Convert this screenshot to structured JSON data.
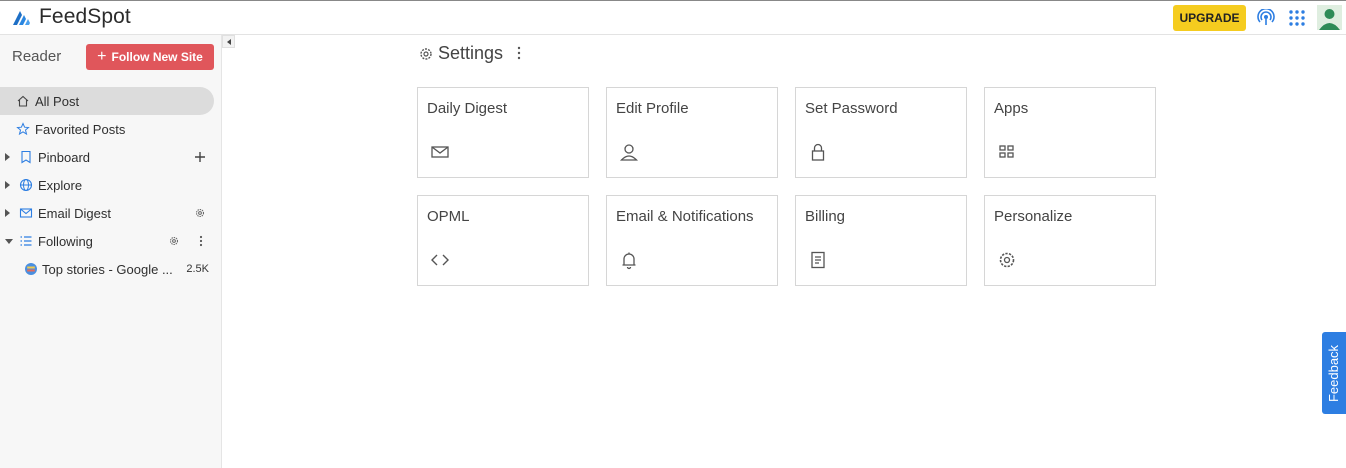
{
  "app": {
    "name": "FeedSpot"
  },
  "header": {
    "upgrade_label": "UPGRADE"
  },
  "sidebar": {
    "reader_label": "Reader",
    "follow_button": "Follow New Site",
    "items": [
      {
        "label": "All Post"
      },
      {
        "label": "Favorited Posts"
      },
      {
        "label": "Pinboard"
      },
      {
        "label": "Explore"
      },
      {
        "label": "Email Digest"
      },
      {
        "label": "Following"
      },
      {
        "label": "Top stories - Google ...",
        "count": "2.5K"
      }
    ]
  },
  "main": {
    "title": "Settings",
    "cards": [
      {
        "label": "Daily Digest",
        "icon": "mail-icon"
      },
      {
        "label": "Edit Profile",
        "icon": "user-icon"
      },
      {
        "label": "Set Password",
        "icon": "lock-icon"
      },
      {
        "label": "Apps",
        "icon": "grid-icon"
      },
      {
        "label": "OPML",
        "icon": "code-icon"
      },
      {
        "label": "Email & Notifications",
        "icon": "bell-icon"
      },
      {
        "label": "Billing",
        "icon": "document-icon"
      },
      {
        "label": "Personalize",
        "icon": "gear-icon"
      }
    ]
  },
  "feedback_label": "Feedback",
  "colors": {
    "accent_blue": "#2d7ee2",
    "follow_red": "#e0565b",
    "upgrade_yellow": "#f5cc1f"
  }
}
